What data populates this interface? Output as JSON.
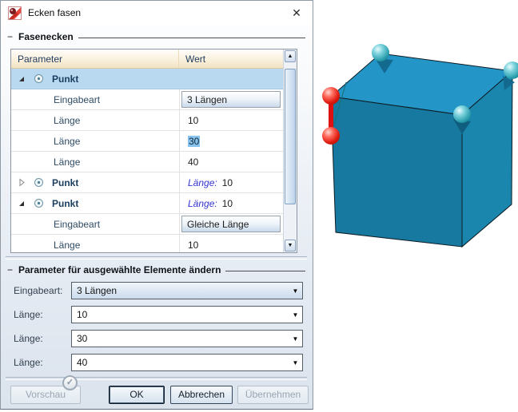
{
  "window": {
    "title": "Ecken fasen"
  },
  "icons": {
    "close": "✕",
    "scroll_up": "▲",
    "scroll_down": "▼",
    "combo_arrow": "▼",
    "check": "✓",
    "collapse_dash": "−"
  },
  "sections": {
    "fasenecken": "Fasenecken",
    "parameter": "Parameter für ausgewählte Elemente ändern"
  },
  "table": {
    "columns": {
      "parameter": "Parameter",
      "wert": "Wert"
    },
    "rows": [
      {
        "label": "Punkt",
        "value": ""
      },
      {
        "label": "Eingabeart",
        "value": "3 Längen"
      },
      {
        "label": "Länge",
        "value": "10"
      },
      {
        "label": "Länge",
        "value": "30"
      },
      {
        "label": "Länge",
        "value": "40"
      },
      {
        "label": "Punkt",
        "summary_label": "Länge:",
        "summary_value": "10"
      },
      {
        "label": "Punkt",
        "summary_label": "Länge:",
        "summary_value": "10"
      },
      {
        "label": "Eingabeart",
        "value": "Gleiche Länge"
      },
      {
        "label": "Länge",
        "value": "10"
      }
    ]
  },
  "form": {
    "fields": [
      {
        "label": "Eingabeart:",
        "value": "3 Längen"
      },
      {
        "label": "Länge:",
        "value": "10"
      },
      {
        "label": "Länge:",
        "value": "30"
      },
      {
        "label": "Länge:",
        "value": "40"
      }
    ]
  },
  "buttons": {
    "vorschau": "Vorschau",
    "ok": "OK",
    "abbrechen": "Abbrechen",
    "uebernehmen": "Übernehmen"
  },
  "colors": {
    "cube_top": "#2395c6",
    "cube_front": "#17799f",
    "cube_right": "#1a86ae",
    "sphere_teal": "#2b9fae",
    "sphere_red": "#e01c10",
    "selected_row": "#b9d9f1",
    "table_header_bottom": "#f1e2c2",
    "accent_text": "#1f3a5f"
  }
}
